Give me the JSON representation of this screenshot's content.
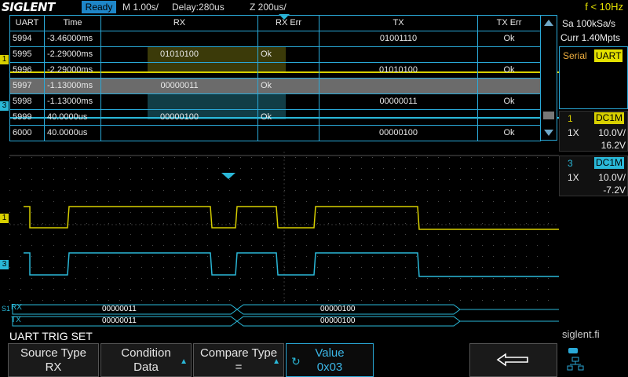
{
  "topbar": {
    "logo": "SIGLENT",
    "status": "Ready",
    "timebase": "M 1.00s/",
    "delay": "Delay:280us",
    "zoom": "Z 200us/",
    "freq": "f < 10Hz"
  },
  "table": {
    "headers": [
      "UART",
      "Time",
      "RX",
      "RX Err",
      "TX",
      "TX Err"
    ],
    "rows": [
      {
        "id": "5994",
        "time": "-3.46000ms",
        "rx": "",
        "rx_err": "",
        "tx": "01001110",
        "tx_err": "Ok"
      },
      {
        "id": "5995",
        "time": "-2.29000ms",
        "rx": "01010100",
        "rx_err": "Ok",
        "tx": "",
        "tx_err": ""
      },
      {
        "id": "5996",
        "time": "-2.29000ms",
        "rx": "",
        "rx_err": "",
        "tx": "01010100",
        "tx_err": "Ok"
      },
      {
        "id": "5997",
        "time": "-1.13000ms",
        "rx": "00000011",
        "rx_err": "Ok",
        "tx": "",
        "tx_err": ""
      },
      {
        "id": "5998",
        "time": "-1.13000ms",
        "rx": "",
        "rx_err": "",
        "tx": "00000011",
        "tx_err": "Ok"
      },
      {
        "id": "5999",
        "time": "40.0000us",
        "rx": "00000100",
        "rx_err": "Ok",
        "tx": "",
        "tx_err": ""
      },
      {
        "id": "6000",
        "time": "40.0000us",
        "rx": "",
        "rx_err": "",
        "tx": "00000100",
        "tx_err": "Ok"
      }
    ],
    "selected_row": 3
  },
  "right_panel": {
    "sample_rate": "Sa 100kSa/s",
    "memory": "Curr 1.40Mpts",
    "serial_label": "Serial",
    "serial_badge": "UART",
    "ch1": {
      "num": "1",
      "coupling": "DC1M",
      "probe": "1X",
      "scale": "10.0V/",
      "offset": "16.2V"
    },
    "ch3": {
      "num": "3",
      "coupling": "DC1M",
      "probe": "1X",
      "scale": "10.0V/",
      "offset": "-7.2V"
    },
    "brand": "siglent.fi"
  },
  "bus": {
    "rx_label": "RX",
    "tx_label": "TX",
    "s_label": "S1",
    "rx_values": [
      "00000011",
      "00000100"
    ],
    "tx_values": [
      "00000011",
      "00000100"
    ]
  },
  "trigger_menu": {
    "title": "UART TRIG SET",
    "keys": [
      {
        "label": "Source Type",
        "value": "RX"
      },
      {
        "label": "Condition",
        "value": "Data"
      },
      {
        "label": "Compare Type",
        "value": "="
      },
      {
        "label": "Value",
        "value": "0x03"
      }
    ]
  },
  "colors": {
    "ch1": "#d8d000",
    "ch3": "#2ab8d8",
    "accent": "#2aa9d8",
    "status": "#1e86c8"
  },
  "icons": {
    "back": "return-arrow-icon",
    "network": "network-icon"
  }
}
